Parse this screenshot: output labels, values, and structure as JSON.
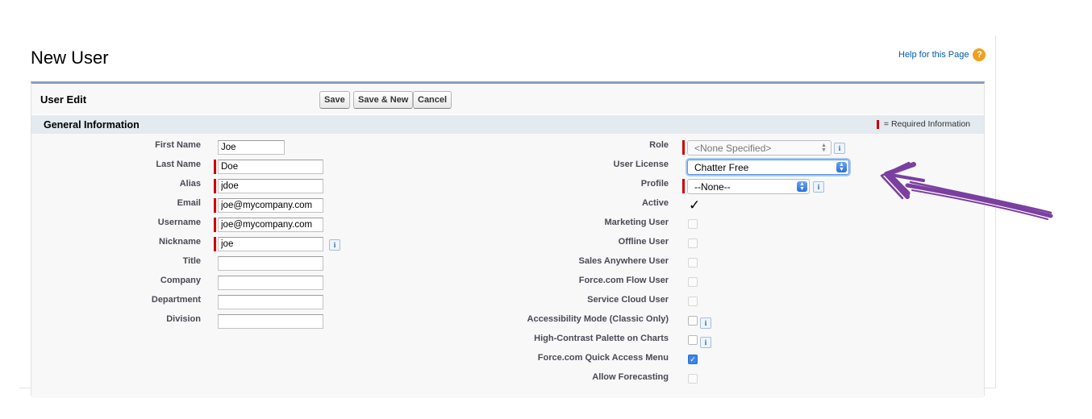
{
  "header": {
    "title": "New User",
    "help_link": "Help for this Page",
    "help_icon": "question-icon"
  },
  "panel": {
    "title": "User Edit",
    "buttons": {
      "save": "Save",
      "save_new": "Save & New",
      "cancel": "Cancel"
    }
  },
  "section": {
    "title": "General Information",
    "required_legend": "= Required Information"
  },
  "left_fields": {
    "first_name": {
      "label": "First Name",
      "value": "Joe"
    },
    "last_name": {
      "label": "Last Name",
      "value": "Doe"
    },
    "alias": {
      "label": "Alias",
      "value": "jdoe"
    },
    "email": {
      "label": "Email",
      "value": "joe@mycompany.com"
    },
    "username": {
      "label": "Username",
      "value": "joe@mycompany.com"
    },
    "nickname": {
      "label": "Nickname",
      "value": "joe"
    },
    "title": {
      "label": "Title",
      "value": ""
    },
    "company": {
      "label": "Company",
      "value": ""
    },
    "department": {
      "label": "Department",
      "value": ""
    },
    "division": {
      "label": "Division",
      "value": ""
    }
  },
  "right_fields": {
    "role": {
      "label": "Role",
      "value": "<None Specified>"
    },
    "user_license": {
      "label": "User License",
      "value": "Chatter Free"
    },
    "profile": {
      "label": "Profile",
      "value": "--None--"
    },
    "active": {
      "label": "Active",
      "checked": true
    },
    "marketing_user": {
      "label": "Marketing User",
      "checked": false
    },
    "offline_user": {
      "label": "Offline User",
      "checked": false
    },
    "sales_anywhere_user": {
      "label": "Sales Anywhere User",
      "checked": false
    },
    "flow_user": {
      "label": "Force.com Flow User",
      "checked": false
    },
    "service_cloud_user": {
      "label": "Service Cloud User",
      "checked": false
    },
    "accessibility_mode": {
      "label": "Accessibility Mode (Classic Only)",
      "checked": false
    },
    "high_contrast": {
      "label": "High-Contrast Palette on Charts",
      "checked": false
    },
    "quick_access_menu": {
      "label": "Force.com Quick Access Menu",
      "checked": true
    },
    "allow_forecasting": {
      "label": "Allow Forecasting",
      "checked": false
    }
  },
  "info_icon_glyph": "i",
  "colors": {
    "required": "#cc0000",
    "section_bg": "#e3eaf0",
    "panel_border": "#8a9ebe",
    "link": "#015ba7",
    "annotation_arrow": "#7b3fa0"
  }
}
